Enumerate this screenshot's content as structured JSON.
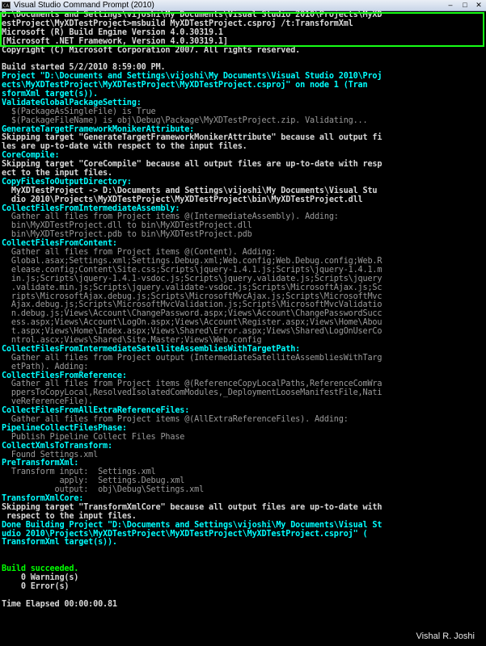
{
  "window": {
    "title": "Visual Studio Command Prompt (2010)",
    "icon": "CA",
    "minimize": "–",
    "maximize": "□",
    "close": "✕"
  },
  "console": {
    "lines": [
      {
        "text": "D:\\Documents and Settings\\vijoshi\\My Documents\\Visual Studio 2010\\Projects\\MyXD",
        "style": "def"
      },
      {
        "text": "estProject\\MyXDTestProject>msbuild MyXDTestProject.csproj /t:TransformXml",
        "style": "def"
      },
      {
        "text": "Microsoft (R) Build Engine Version 4.0.30319.1",
        "style": "def"
      },
      {
        "text": "[Microsoft .NET Framework, Version 4.0.30319.1]",
        "style": "def"
      },
      {
        "text": "Copyright (C) Microsoft Corporation 2007. All rights reserved.",
        "style": "def"
      },
      {
        "text": "",
        "style": "def"
      },
      {
        "text": "Build started 5/2/2010 8:59:00 PM.",
        "style": "def"
      },
      {
        "text": "Project \"D:\\Documents and Settings\\vijoshi\\My Documents\\Visual Studio 2010\\Proj",
        "style": "cyan"
      },
      {
        "text": "ects\\MyXDTestProject\\MyXDTestProject\\MyXDTestProject.csproj\" on node 1 (Tran",
        "style": "cyan"
      },
      {
        "text": "sformXml target(s)).",
        "style": "cyan"
      },
      {
        "text": "ValidateGlobalPackageSetting:",
        "style": "cyan"
      },
      {
        "text": "  $(PackageAsSingleFile) is True",
        "style": "dim"
      },
      {
        "text": "  $(PackageFileName) is obj\\Debug\\Package\\MyXDTestProject.zip. Validating...",
        "style": "dim"
      },
      {
        "text": "GenerateTargetFrameworkMonikerAttribute:",
        "style": "cyan"
      },
      {
        "text": "Skipping target \"GenerateTargetFrameworkMonikerAttribute\" because all output fi",
        "style": "def"
      },
      {
        "text": "les are up-to-date with respect to the input files.",
        "style": "def"
      },
      {
        "text": "CoreCompile:",
        "style": "cyan"
      },
      {
        "text": "Skipping target \"CoreCompile\" because all output files are up-to-date with resp",
        "style": "def"
      },
      {
        "text": "ect to the input files.",
        "style": "def"
      },
      {
        "text": "CopyFilesToOutputDirectory:",
        "style": "cyan"
      },
      {
        "text": "  MyXDTestProject -> D:\\Documents and Settings\\vijoshi\\My Documents\\Visual Stu",
        "style": "def"
      },
      {
        "text": "  dio 2010\\Projects\\MyXDTestProject\\MyXDTestProject\\bin\\MyXDTestProject.dll",
        "style": "def"
      },
      {
        "text": "CollectFilesFromIntermediateAssembly:",
        "style": "cyan"
      },
      {
        "text": "  Gather all files from Project items @(IntermediateAssembly). Adding:",
        "style": "dim"
      },
      {
        "text": "  bin\\MyXDTestProject.dll to bin\\MyXDTestProject.dll",
        "style": "dim"
      },
      {
        "text": "  bin\\MyXDTestProject.pdb to bin\\MyXDTestProject.pdb",
        "style": "dim"
      },
      {
        "text": "CollectFilesFromContent:",
        "style": "cyan"
      },
      {
        "text": "  Gather all files from Project items @(Content). Adding:",
        "style": "dim"
      },
      {
        "text": "  Global.asax;Settings.xml;Settings.Debug.xml;Web.config;Web.Debug.config;Web.R",
        "style": "dim"
      },
      {
        "text": "  elease.config;Content\\Site.css;Scripts\\jquery-1.4.1.js;Scripts\\jquery-1.4.1.m",
        "style": "dim"
      },
      {
        "text": "  in.js;Scripts\\jquery-1.4.1-vsdoc.js;Scripts\\jquery.validate.js;Scripts\\jquery",
        "style": "dim"
      },
      {
        "text": "  .validate.min.js;Scripts\\jquery.validate-vsdoc.js;Scripts\\MicrosoftAjax.js;Sc",
        "style": "dim"
      },
      {
        "text": "  ripts\\MicrosoftAjax.debug.js;Scripts\\MicrosoftMvcAjax.js;Scripts\\MicrosoftMvc",
        "style": "dim"
      },
      {
        "text": "  Ajax.debug.js;Scripts\\MicrosoftMvcValidation.js;Scripts\\MicrosoftMvcValidatio",
        "style": "dim"
      },
      {
        "text": "  n.debug.js;Views\\Account\\ChangePassword.aspx;Views\\Account\\ChangePasswordSucc",
        "style": "dim"
      },
      {
        "text": "  ess.aspx;Views\\Account\\LogOn.aspx;Views\\Account\\Register.aspx;Views\\Home\\Abou",
        "style": "dim"
      },
      {
        "text": "  t.aspx;Views\\Home\\Index.aspx;Views\\Shared\\Error.aspx;Views\\Shared\\LogOnUserCo",
        "style": "dim"
      },
      {
        "text": "  ntrol.ascx;Views\\Shared\\Site.Master;Views\\Web.config",
        "style": "dim"
      },
      {
        "text": "CollectFilesFromIntermediateSatelliteAssembliesWithTargetPath:",
        "style": "cyan"
      },
      {
        "text": "  Gather all files from Project output (IntermediateSatelliteAssembliesWithTarg",
        "style": "dim"
      },
      {
        "text": "  etPath). Adding:",
        "style": "dim"
      },
      {
        "text": "CollectFilesFromReference:",
        "style": "cyan"
      },
      {
        "text": "  Gather all files from Project items @(ReferenceCopyLocalPaths,ReferenceComWra",
        "style": "dim"
      },
      {
        "text": "  ppersToCopyLocal,ResolvedIsolatedComModules,_DeploymentLooseManifestFile,Nati",
        "style": "dim"
      },
      {
        "text": "  veReferenceFile).",
        "style": "dim"
      },
      {
        "text": "CollectFilesFromAllExtraReferenceFiles:",
        "style": "cyan"
      },
      {
        "text": "  Gather all files from Project items @(AllExtraReferenceFiles). Adding:",
        "style": "dim"
      },
      {
        "text": "PipelineCollectFilesPhase:",
        "style": "cyan"
      },
      {
        "text": "  Publish Pipeline Collect Files Phase",
        "style": "dim"
      },
      {
        "text": "CollectXmlsToTransform:",
        "style": "cyan"
      },
      {
        "text": "  Found Settings.xml",
        "style": "dim"
      },
      {
        "text": "PreTransformXml:",
        "style": "cyan"
      },
      {
        "text": "  Transform input:  Settings.xml",
        "style": "dim"
      },
      {
        "text": "            apply:  Settings.Debug.xml",
        "style": "dim"
      },
      {
        "text": "           output:  obj\\Debug\\Settings.xml",
        "style": "dim"
      },
      {
        "text": "TransformXmlCore:",
        "style": "cyan"
      },
      {
        "text": "Skipping target \"TransformXmlCore\" because all output files are up-to-date with",
        "style": "def"
      },
      {
        "text": " respect to the input files.",
        "style": "def"
      },
      {
        "text": "Done Building Project \"D:\\Documents and Settings\\vijoshi\\My Documents\\Visual St",
        "style": "cyan"
      },
      {
        "text": "udio 2010\\Projects\\MyXDTestProject\\MyXDTestProject\\MyXDTestProject.csproj\" (",
        "style": "cyan"
      },
      {
        "text": "TransformXml target(s)).",
        "style": "cyan"
      },
      {
        "text": "",
        "style": "def"
      },
      {
        "text": "",
        "style": "def"
      },
      {
        "text": "Build succeeded.",
        "style": "green"
      },
      {
        "text": "    0 Warning(s)",
        "style": "def"
      },
      {
        "text": "    0 Error(s)",
        "style": "def"
      },
      {
        "text": "",
        "style": "def"
      },
      {
        "text": "Time Elapsed 00:00:00.81",
        "style": "def"
      }
    ]
  },
  "watermark": "Vishal R. Joshi",
  "colors": {
    "background": "#000000",
    "text": "#d8d8d8",
    "cyan": "#00ffff",
    "green": "#00ff00",
    "highlight_box": "#16ff16"
  }
}
